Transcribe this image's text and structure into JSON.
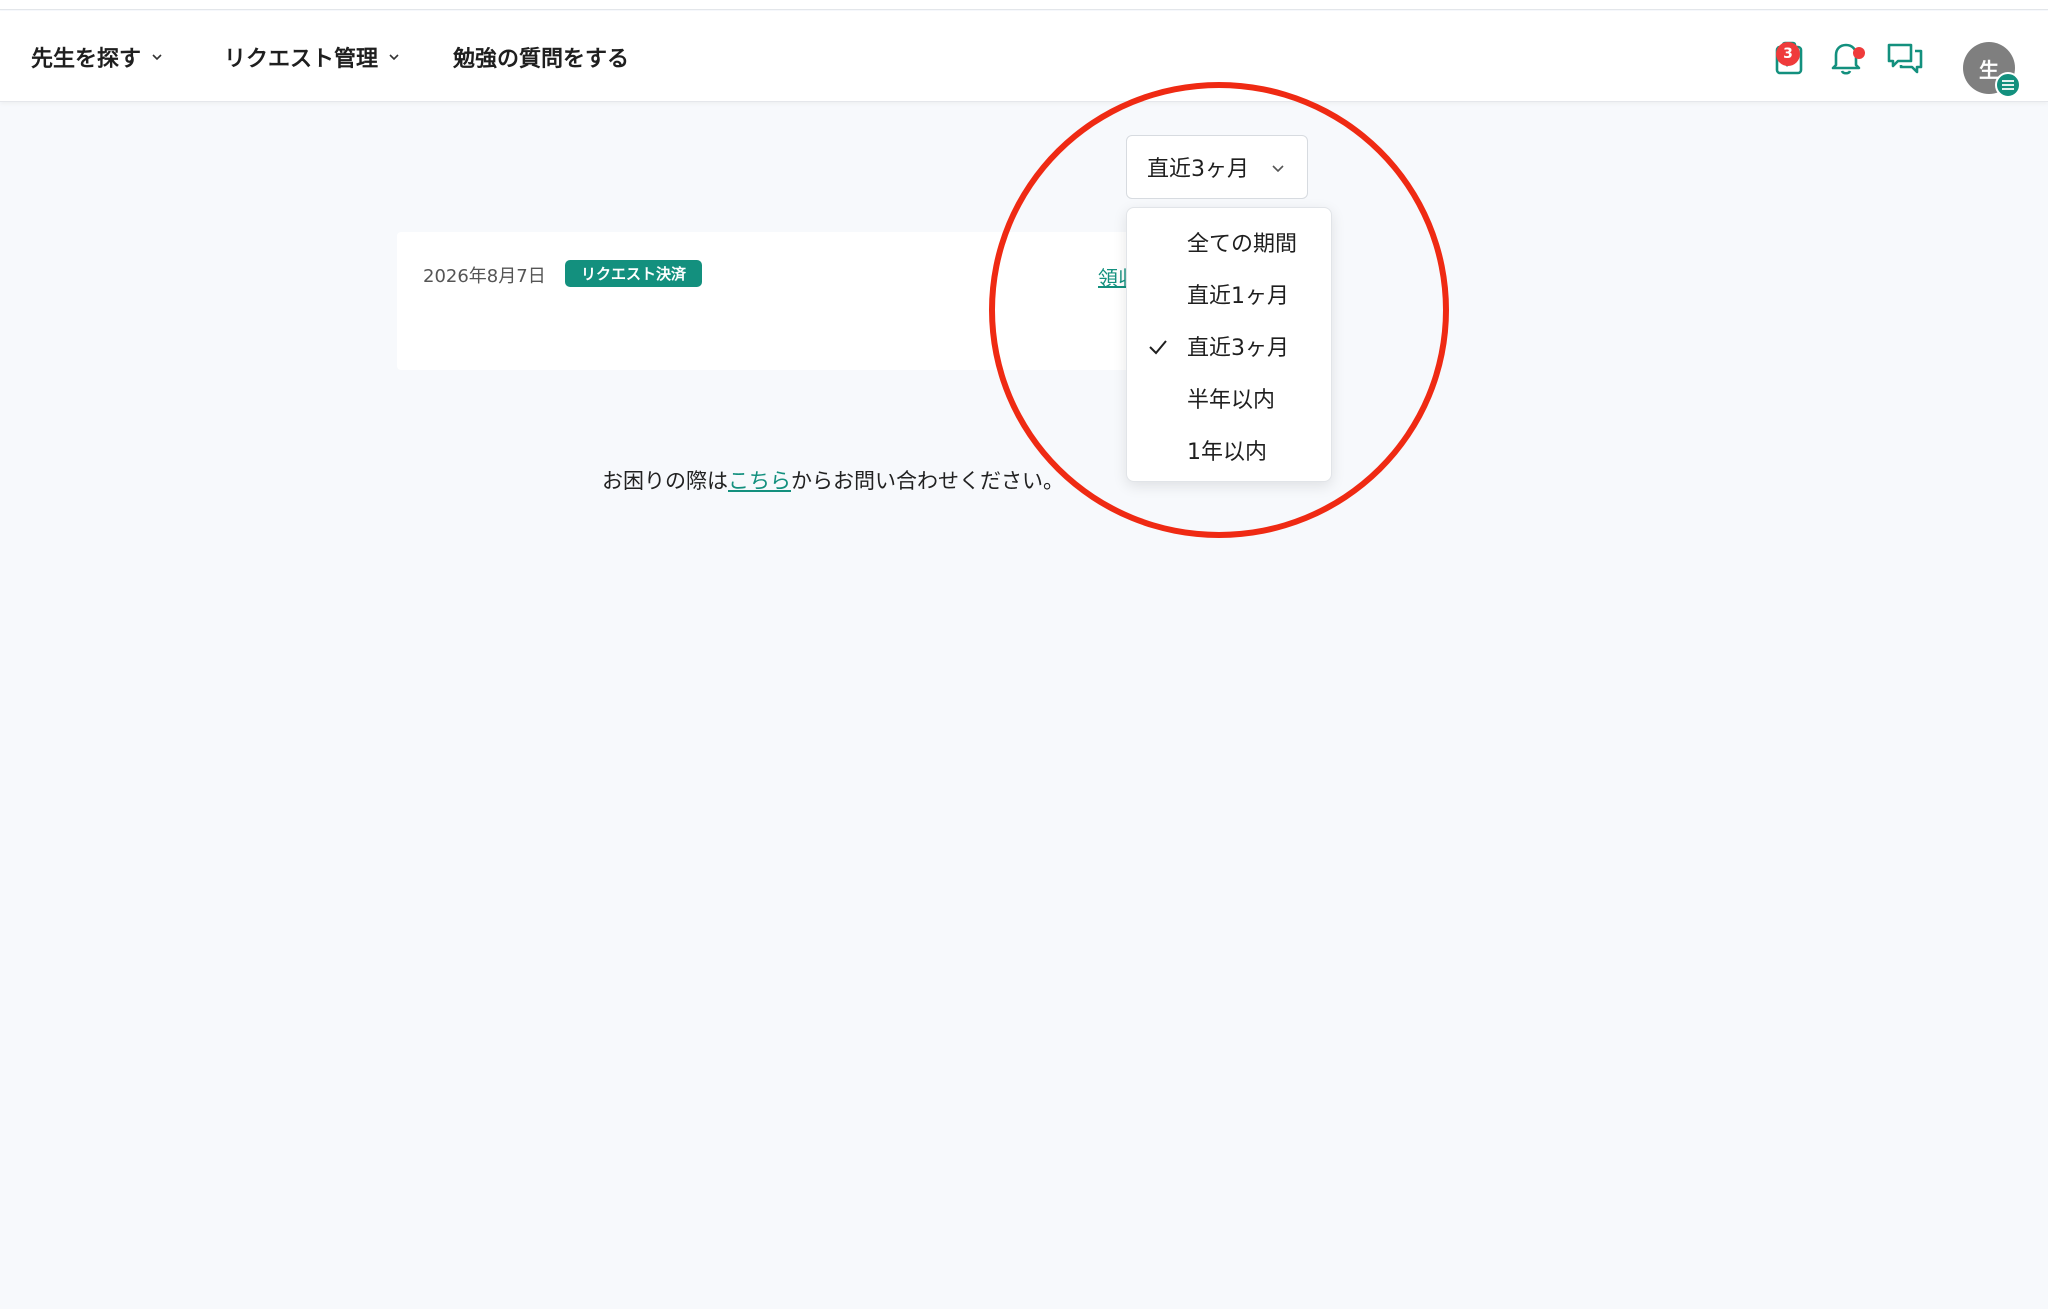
{
  "header": {
    "nav": [
      {
        "label": "先生を探す"
      },
      {
        "label": "リクエスト管理"
      },
      {
        "label": "勉強の質問をする"
      }
    ],
    "task_badge_count": "3",
    "avatar_initial": "生",
    "icons": [
      "task-check-icon",
      "bell-icon",
      "chat-icon",
      "menu-icon"
    ]
  },
  "period_filter": {
    "selected": "直近3ヶ月",
    "options": [
      "全ての期間",
      "直近1ヶ月",
      "直近3ヶ月",
      "半年以内",
      "1年以内"
    ]
  },
  "history": [
    {
      "date": "2026年8月7日",
      "status": "リクエスト決済",
      "receipt_link": "領収"
    }
  ],
  "help": {
    "prefix": "お困りの際は",
    "link": "こちら",
    "suffix": "からお問い合わせください。"
  },
  "colors": {
    "accent": "#13907e",
    "badge": "#ef3b3b",
    "annotation": "#ef2a13"
  }
}
